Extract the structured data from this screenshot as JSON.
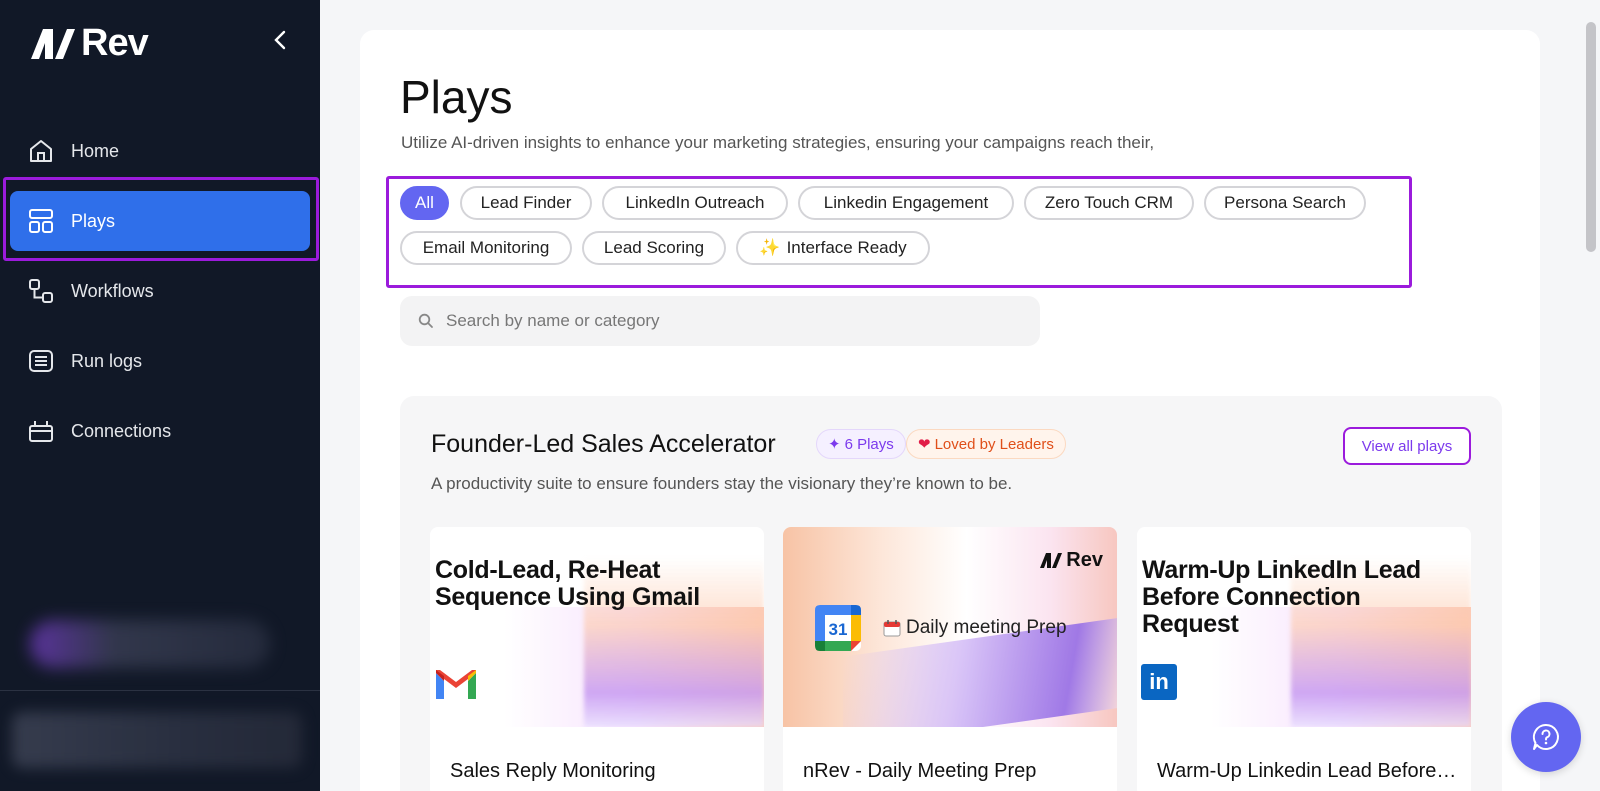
{
  "app": {
    "logo_text": "Rev"
  },
  "sidebar": {
    "items": [
      {
        "label": "Home",
        "icon": "home-icon"
      },
      {
        "label": "Plays",
        "icon": "layout-grid-icon",
        "active": true
      },
      {
        "label": "Workflows",
        "icon": "workflow-icon"
      },
      {
        "label": "Run logs",
        "icon": "archive-icon"
      },
      {
        "label": "Connections",
        "icon": "plug-icon"
      }
    ]
  },
  "page": {
    "title": "Plays",
    "subtitle": "Utilize AI-driven insights to enhance your marketing strategies, ensuring your campaigns reach their,"
  },
  "filters": [
    {
      "label": "All",
      "active": true
    },
    {
      "label": "Lead Finder"
    },
    {
      "label": "LinkedIn Outreach"
    },
    {
      "label": "Linkedin Engagement"
    },
    {
      "label": "Zero Touch CRM"
    },
    {
      "label": "Persona Search"
    },
    {
      "label": "Email Monitoring"
    },
    {
      "label": "Lead Scoring"
    },
    {
      "label": "Interface Ready",
      "prefix": "✨"
    }
  ],
  "search": {
    "placeholder": "Search by name or category"
  },
  "section": {
    "title": "Founder-Led Sales Accelerator",
    "plays_badge": "6 Plays",
    "plays_badge_icon": "✦",
    "loved_badge": "Loved by Leaders",
    "loved_badge_icon": "❤",
    "view_all_label": "View all plays",
    "description": "A productivity suite to ensure founders stay the visionary they’re known to be."
  },
  "cards": [
    {
      "thumb_title": "Cold-Lead, Re-Heat Sequence Using Gmail",
      "name": "Sales Reply Monitoring",
      "icon": "gmail-icon"
    },
    {
      "thumb_title": "Daily meeting Prep",
      "thumb_logo": "Rev",
      "name": "nRev - Daily Meeting Prep",
      "icon": "google-calendar-icon",
      "calendar_day": "31"
    },
    {
      "thumb_title": "Warm-Up LinkedIn Lead Before Connection Request",
      "name": "Warm-Up Linkedin Lead Before Connection Request",
      "icon": "linkedin-icon",
      "icon_text": "in"
    }
  ],
  "colors": {
    "sidebar_bg": "#111827",
    "active_nav": "#2f6fea",
    "accent": "#6366f1",
    "highlight": "#9b1bdc"
  }
}
